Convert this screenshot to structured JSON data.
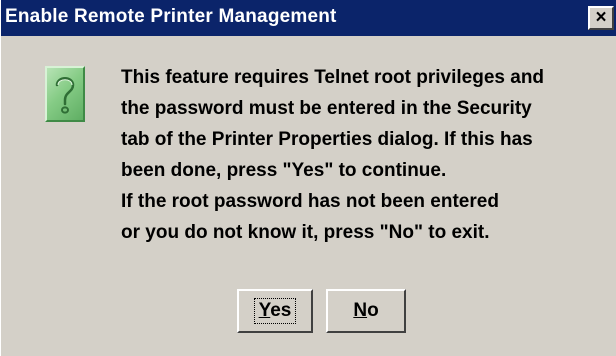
{
  "window": {
    "title": "Enable Remote Printer Management",
    "close_glyph": "×",
    "colors": {
      "titlebar": "#0b246a",
      "dialog_background": "#d4d0c8",
      "icon": "#86cc86"
    }
  },
  "icon": {
    "name": "question-icon"
  },
  "message": {
    "lines": [
      "This feature requires Telnet root privileges and",
      "the password must be entered in the Security",
      "tab of the Printer Properties dialog.  If this has",
      "been done, press \"Yes\" to continue.",
      "If the root password has not been entered",
      "or you do not know it, press \"No\" to exit."
    ]
  },
  "buttons": {
    "yes": {
      "mnemonic": "Y",
      "rest": "es",
      "focused": true
    },
    "no": {
      "mnemonic": "N",
      "rest": "o",
      "focused": false
    }
  }
}
